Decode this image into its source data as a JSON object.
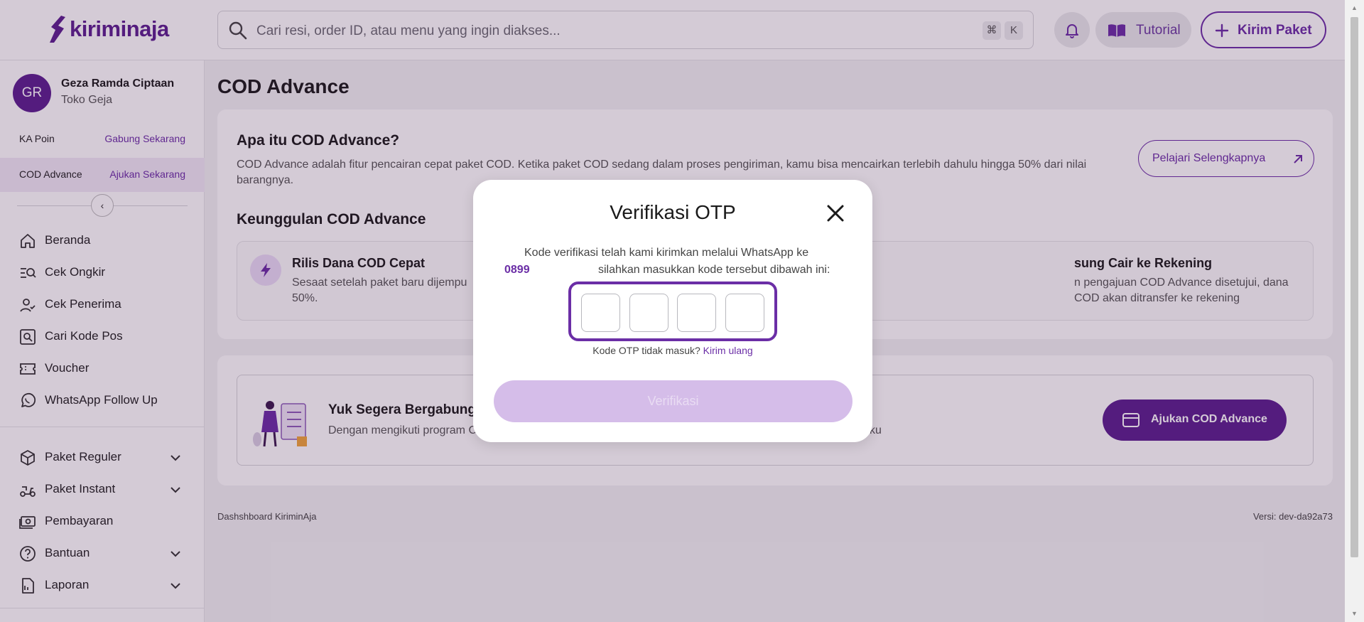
{
  "header": {
    "logo_text": "kiriminaja",
    "search_placeholder": "Cari resi, order ID, atau menu yang ingin diakses...",
    "shortcut_keys": [
      "⌘",
      "K"
    ],
    "tutorial_label": "Tutorial",
    "kirim_label": "Kirim Paket"
  },
  "sidebar": {
    "avatar_initials": "GR",
    "user_name": "Geza Ramda Ciptaan",
    "shop_name": "Toko Geja",
    "promos": [
      {
        "label": "KA Poin",
        "action": "Gabung Sekarang"
      },
      {
        "label": "COD Advance",
        "action": "Ajukan Sekarang"
      }
    ],
    "collapse_glyph": "‹",
    "nav": [
      {
        "label": "Beranda",
        "icon": "home-icon"
      },
      {
        "label": "Cek Ongkir",
        "icon": "search-list-icon"
      },
      {
        "label": "Cek Penerima",
        "icon": "user-check-icon"
      },
      {
        "label": "Cari Kode Pos",
        "icon": "zoom-box-icon"
      },
      {
        "label": "Voucher",
        "icon": "ticket-icon"
      },
      {
        "label": "WhatsApp Follow Up",
        "icon": "whatsapp-icon"
      }
    ],
    "nav2": [
      {
        "label": "Paket Reguler",
        "icon": "box-icon",
        "expandable": true
      },
      {
        "label": "Paket Instant",
        "icon": "scooter-icon",
        "expandable": true
      },
      {
        "label": "Pembayaran",
        "icon": "money-icon",
        "expandable": false
      },
      {
        "label": "Bantuan",
        "icon": "help-icon",
        "expandable": true
      },
      {
        "label": "Laporan",
        "icon": "report-icon",
        "expandable": true
      }
    ]
  },
  "main": {
    "page_title": "COD Advance",
    "intro_title": "Apa itu COD Advance?",
    "intro_desc": "COD Advance adalah fitur pencairan cepat paket COD. Ketika paket COD sedang dalam proses pengiriman, kamu bisa mencairkan terlebih dahulu hingga 50% dari nilai barangnya.",
    "learn_more": "Pelajari Selengkapnya",
    "advantages_title": "Keunggulan COD Advance",
    "features": [
      {
        "title": "Rilis Dana COD Cepat",
        "desc": "Sesaat setelah paket baru dijempu",
        "desc2": "50%."
      },
      {
        "title": "sung Cair ke Rekening",
        "desc": "n pengajuan COD Advance disetujui, dana COD akan ditransfer ke rekening",
        "desc2": ""
      }
    ],
    "join_title": "Yuk Segera Bergabung d",
    "join_desc": "Dengan mengikuti program C",
    "join_desc_tail": "ku",
    "apply_label": "Ajukan COD Advance",
    "footer_left": "Dashshboard KiriminAja",
    "footer_right": "Versi: dev-da92a73"
  },
  "modal": {
    "title": "Verifikasi OTP",
    "text1": "Kode verifikasi telah kami kirimkan melalui WhatsApp ke",
    "phone": "0899",
    "text2": "silahkan masukkan kode tersebut dibawah ini:",
    "otp_values": [
      "",
      "",
      "",
      ""
    ],
    "resend_prompt": "Kode OTP tidak masuk?",
    "resend_link": "Kirim ulang",
    "verify_label": "Verifikasi"
  },
  "colors": {
    "brand": "#5b1f8f",
    "accent": "#6b2ea6",
    "verify_disabled": "#d5bde9"
  }
}
